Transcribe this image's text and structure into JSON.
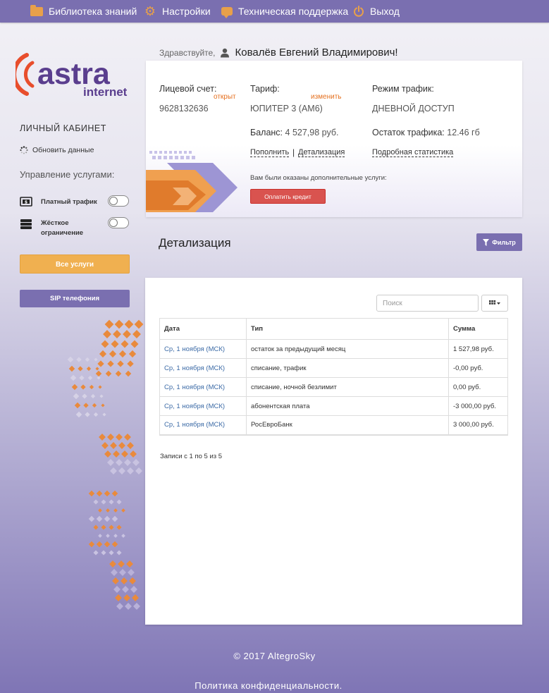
{
  "nav": {
    "knowledge": "Библиотека знаний",
    "settings": "Настройки",
    "support": "Техническая поддержка",
    "logout": "Выход"
  },
  "logo": {
    "word": "astra",
    "sub": "internet"
  },
  "sidebar": {
    "title": "ЛИЧНЫЙ КАБИНЕТ",
    "refresh": "Обновить данные",
    "manage": "Управление услугами:",
    "paid_traffic": "Платный трафик",
    "hard_limit_1": "Жёсткое",
    "hard_limit_2": "ограничение",
    "all_services": "Все услуги",
    "sip": "SIP телефония",
    "toggles": {
      "paid_traffic_on": false,
      "hard_limit_on": false
    }
  },
  "greeting": {
    "hello": "Здравствуйте,",
    "name": "Ковалёв Евгений Владимирович!"
  },
  "account": {
    "account_label": "Лицевой счет:",
    "account_status": "открыт",
    "account_number": "9628132636",
    "tariff_label": "Тариф:",
    "tariff_change": "изменить",
    "tariff_value": "ЮПИТЕР 3 (АМ6)",
    "mode_label": "Режим трафик:",
    "mode_value": "ДНЕВНОЙ ДОСТУП",
    "balance_label": "Баланс:",
    "balance_value": "4 527,98 руб.",
    "traffic_left_label": "Остаток трафика:",
    "traffic_left_value": "12.46 гб",
    "topup_link": "Пополнить",
    "separator": "|",
    "detail_link": "Детализация",
    "stats_link": "Подробная статистика",
    "extra_note": "Вам были оказаны дополнительные услуги:",
    "credit_button": "Оплатить кредит"
  },
  "details": {
    "title": "Детализация",
    "filter": "Фильтр",
    "search_placeholder": "Поиск",
    "columns": [
      "Дата",
      "Тип",
      "Сумма"
    ],
    "rows": [
      {
        "date": "Ср, 1 ноября (МСК)",
        "type": "остаток за предыдущий месяц",
        "amount": "1 527,98 руб."
      },
      {
        "date": "Ср, 1 ноября (МСК)",
        "type": "списание, трафик",
        "amount": "-0,00 руб."
      },
      {
        "date": "Ср, 1 ноября (МСК)",
        "type": "списание, ночной безлимит",
        "amount": "0,00 руб."
      },
      {
        "date": "Ср, 1 ноября (МСК)",
        "type": "абонентская плата",
        "amount": "-3 000,00 руб."
      },
      {
        "date": "Ср, 1 ноября (МСК)",
        "type": "РосЕвроБанк",
        "amount": "3 000,00 руб."
      }
    ],
    "records_info": "Записи с 1 по 5 из 5"
  },
  "footer": {
    "copyright": "© 2017 AltegroSky",
    "policy": "Политика конфиденциальности."
  },
  "colors": {
    "brand_purple": "#7a6fb0",
    "orange": "#e8a04a",
    "red": "#d9534f",
    "link_blue": "#3b6aa6"
  }
}
